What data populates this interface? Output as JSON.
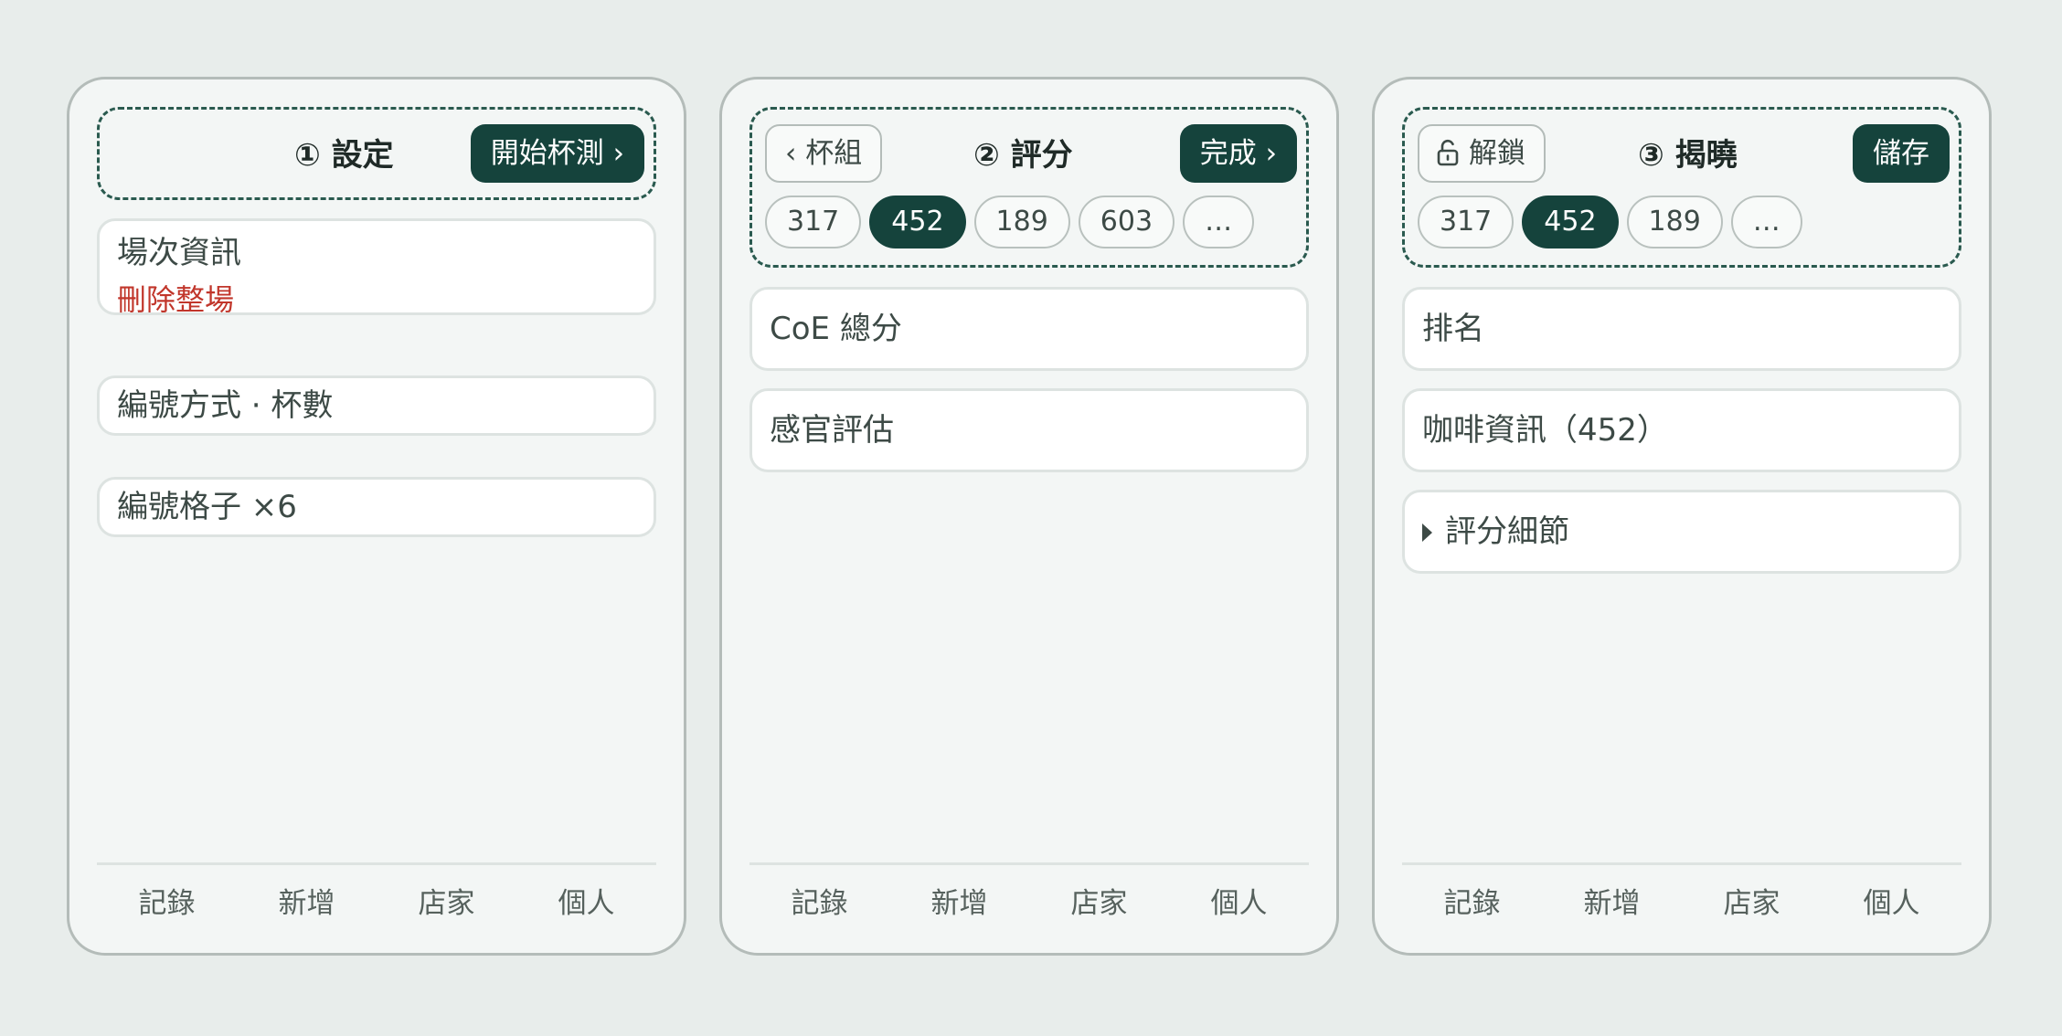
{
  "screens": [
    {
      "title": "① 設定",
      "primary_button": "開始杯測 ›",
      "cards": [
        {
          "label": "場次資訊",
          "action": "刪除整場"
        },
        {
          "label": "編號方式 · 杯數"
        },
        {
          "label": "編號格子 ×6"
        }
      ]
    },
    {
      "title": "② 評分",
      "back_button": "‹ 杯組",
      "primary_button": "完成 ›",
      "chips": [
        "317",
        "452",
        "189",
        "603",
        "…"
      ],
      "active_chip": "452",
      "cards": [
        {
          "label": "CoE 總分"
        },
        {
          "label": "感官評估"
        }
      ]
    },
    {
      "title": "③ 揭曉",
      "unlock_button": "解鎖",
      "primary_button": "儲存",
      "chips": [
        "317",
        "452",
        "189",
        "…"
      ],
      "active_chip": "452",
      "cards": [
        {
          "label": "排名"
        },
        {
          "label": "咖啡資訊（452）"
        },
        {
          "label": "評分細節"
        }
      ]
    }
  ],
  "tabbar": [
    "記錄",
    "新增",
    "店家",
    "個人"
  ],
  "icons": {
    "unlock": "unlock-icon",
    "disclosure": "disclosure-triangle-icon"
  },
  "colors": {
    "accent": "#15433c",
    "danger": "#c1362b",
    "background": "#e8edeb"
  }
}
